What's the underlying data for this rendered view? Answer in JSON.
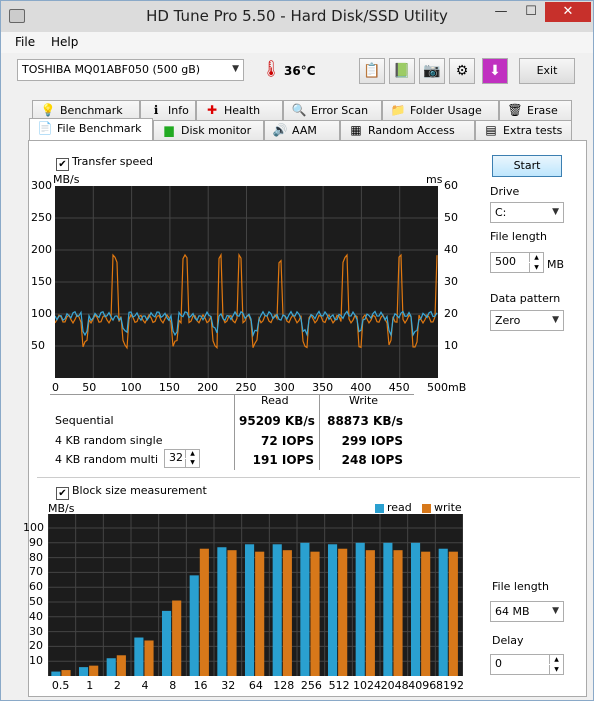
{
  "window": {
    "title": "HD Tune Pro 5.50 - Hard Disk/SSD Utility",
    "min": "—",
    "max": "☐",
    "close": "✕"
  },
  "menu": [
    "File",
    "Help"
  ],
  "toolbar": {
    "drive": "TOSHIBA MQ01ABF050 (500 gB)",
    "temperature": "36°C",
    "exit": "Exit"
  },
  "tabs_top": [
    "Benchmark",
    "Info",
    "Health",
    "Error Scan",
    "Folder Usage",
    "Erase"
  ],
  "tabs_bottom": [
    "File Benchmark",
    "Disk monitor",
    "AAM",
    "Random Access",
    "Extra tests"
  ],
  "transfer": {
    "checkbox_label": "Transfer speed",
    "checked": true,
    "start": "Start",
    "drive_label": "Drive",
    "drive_value": "C:",
    "file_length_label": "File length",
    "file_length_value": "500",
    "file_length_unit": "MB",
    "pattern_label": "Data pattern",
    "pattern_value": "Zero",
    "y_unit_left": "MB/s",
    "y_unit_right": "ms",
    "y_ticks_left": [
      "300",
      "250",
      "200",
      "150",
      "100",
      "50"
    ],
    "y_ticks_right": [
      "60",
      "50",
      "40",
      "30",
      "20",
      "10"
    ],
    "x_ticks": [
      "0",
      "50",
      "100",
      "150",
      "200",
      "250",
      "300",
      "350",
      "400",
      "450",
      "500mB"
    ]
  },
  "results": {
    "head_read": "Read",
    "head_write": "Write",
    "rows": [
      {
        "label": "Sequential",
        "read": "95209 KB/s",
        "write": "88873 KB/s"
      },
      {
        "label": "4 KB random single",
        "read": "72 IOPS",
        "write": "299 IOPS"
      },
      {
        "label": "4 KB random multi",
        "read": "191 IOPS",
        "write": "248 IOPS"
      }
    ],
    "queue_depth": "32"
  },
  "block": {
    "checkbox_label": "Block size measurement",
    "checked": true,
    "legend_read": "read",
    "legend_write": "write",
    "file_length_label": "File length",
    "file_length_value": "64 MB",
    "delay_label": "Delay",
    "delay_value": "0",
    "colors": {
      "read": "#2aa0d0",
      "write": "#d7781a"
    }
  },
  "chart_data": {
    "type": "bar",
    "ylabel": "MB/s",
    "ylim": [
      0,
      100
    ],
    "y_ticks": [
      "100",
      "90",
      "80",
      "70",
      "60",
      "50",
      "40",
      "30",
      "20",
      "10"
    ],
    "categories": [
      "0.5",
      "1",
      "2",
      "4",
      "8",
      "16",
      "32",
      "64",
      "128",
      "256",
      "512",
      "1024",
      "2048",
      "4096",
      "8192"
    ],
    "series": [
      {
        "name": "read",
        "values": [
          3,
          6,
          12,
          26,
          44,
          68,
          87,
          89,
          89,
          90,
          89,
          90,
          90,
          90,
          86
        ]
      },
      {
        "name": "write",
        "values": [
          4,
          7,
          14,
          24,
          51,
          86,
          85,
          84,
          85,
          84,
          86,
          85,
          85,
          84,
          84
        ]
      }
    ]
  }
}
